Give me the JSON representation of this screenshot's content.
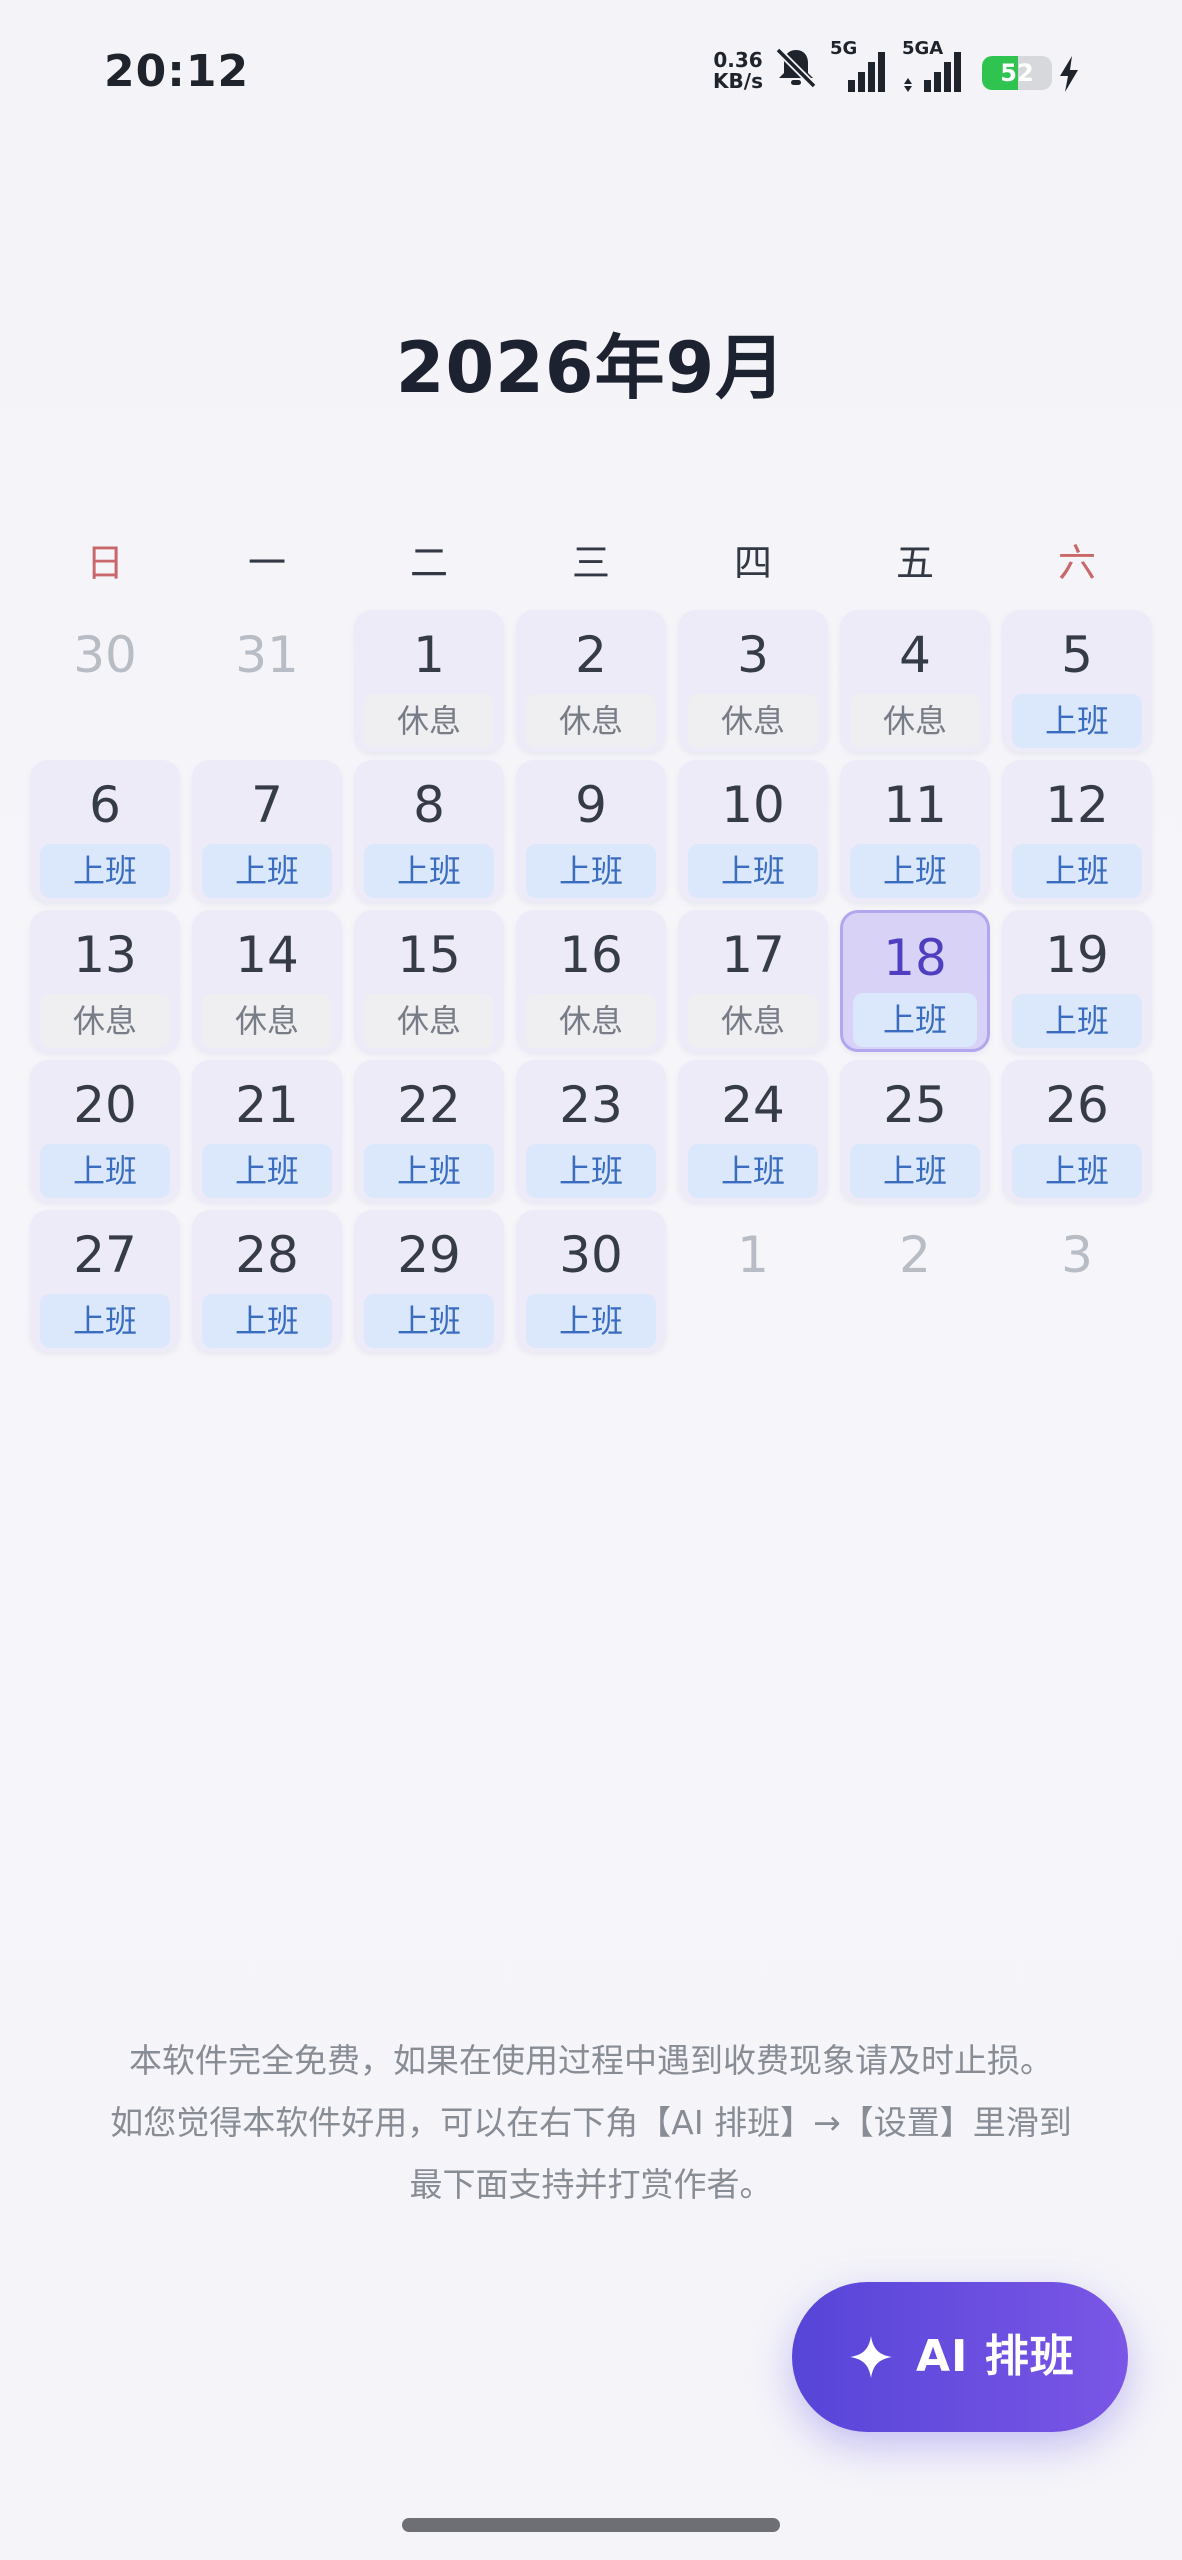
{
  "status_bar": {
    "time": "20:12",
    "net_speed_value": "0.36",
    "net_speed_unit": "KB/s",
    "signal1_label": "5G",
    "signal2_label": "5GA",
    "battery_level": 52,
    "battery_text": "52",
    "battery_color": "#2fc34f",
    "icons": [
      "bell-mute-icon",
      "signal-icon",
      "signal-icon",
      "battery-icon",
      "charging-bolt-icon"
    ]
  },
  "calendar": {
    "title": "2026年9月",
    "weekdays": [
      "日",
      "一",
      "二",
      "三",
      "四",
      "五",
      "六"
    ],
    "weeks": [
      [
        {
          "day": "30",
          "muted": true
        },
        {
          "day": "31",
          "muted": true
        },
        {
          "day": "1",
          "tag": "休息",
          "type": "rest"
        },
        {
          "day": "2",
          "tag": "休息",
          "type": "rest"
        },
        {
          "day": "3",
          "tag": "休息",
          "type": "rest"
        },
        {
          "day": "4",
          "tag": "休息",
          "type": "rest"
        },
        {
          "day": "5",
          "tag": "上班",
          "type": "work"
        }
      ],
      [
        {
          "day": "6",
          "tag": "上班",
          "type": "work"
        },
        {
          "day": "7",
          "tag": "上班",
          "type": "work"
        },
        {
          "day": "8",
          "tag": "上班",
          "type": "work"
        },
        {
          "day": "9",
          "tag": "上班",
          "type": "work"
        },
        {
          "day": "10",
          "tag": "上班",
          "type": "work"
        },
        {
          "day": "11",
          "tag": "上班",
          "type": "work"
        },
        {
          "day": "12",
          "tag": "上班",
          "type": "work"
        }
      ],
      [
        {
          "day": "13",
          "tag": "休息",
          "type": "rest"
        },
        {
          "day": "14",
          "tag": "休息",
          "type": "rest"
        },
        {
          "day": "15",
          "tag": "休息",
          "type": "rest"
        },
        {
          "day": "16",
          "tag": "休息",
          "type": "rest"
        },
        {
          "day": "17",
          "tag": "休息",
          "type": "rest"
        },
        {
          "day": "18",
          "tag": "上班",
          "type": "work",
          "today": true
        },
        {
          "day": "19",
          "tag": "上班",
          "type": "work"
        }
      ],
      [
        {
          "day": "20",
          "tag": "上班",
          "type": "work"
        },
        {
          "day": "21",
          "tag": "上班",
          "type": "work"
        },
        {
          "day": "22",
          "tag": "上班",
          "type": "work"
        },
        {
          "day": "23",
          "tag": "上班",
          "type": "work"
        },
        {
          "day": "24",
          "tag": "上班",
          "type": "work"
        },
        {
          "day": "25",
          "tag": "上班",
          "type": "work"
        },
        {
          "day": "26",
          "tag": "上班",
          "type": "work"
        }
      ],
      [
        {
          "day": "27",
          "tag": "上班",
          "type": "work"
        },
        {
          "day": "28",
          "tag": "上班",
          "type": "work"
        },
        {
          "day": "29",
          "tag": "上班",
          "type": "work"
        },
        {
          "day": "30",
          "tag": "上班",
          "type": "work"
        },
        {
          "day": "1",
          "muted": true
        },
        {
          "day": "2",
          "muted": true
        },
        {
          "day": "3",
          "muted": true
        }
      ]
    ],
    "colors": {
      "weekend_header": "#c9686a",
      "work_tag_bg": "#dbe8fb",
      "work_tag_text": "#3a6dbf",
      "rest_tag_bg": "#efeff2",
      "today_bg": "#d8d2f6"
    }
  },
  "notice": {
    "line1": "本软件完全免费，如果在使用过程中遇到收费现象请及时止损。",
    "line2": "如您觉得本软件好用，可以在右下角【AI 排班】→【设置】里滑到",
    "line3": "最下面支持并打赏作者。"
  },
  "ai_button": {
    "label": "AI 排班",
    "icon": "sparkle-icon",
    "gradient": [
      "#5645d8",
      "#7a56e6"
    ]
  }
}
